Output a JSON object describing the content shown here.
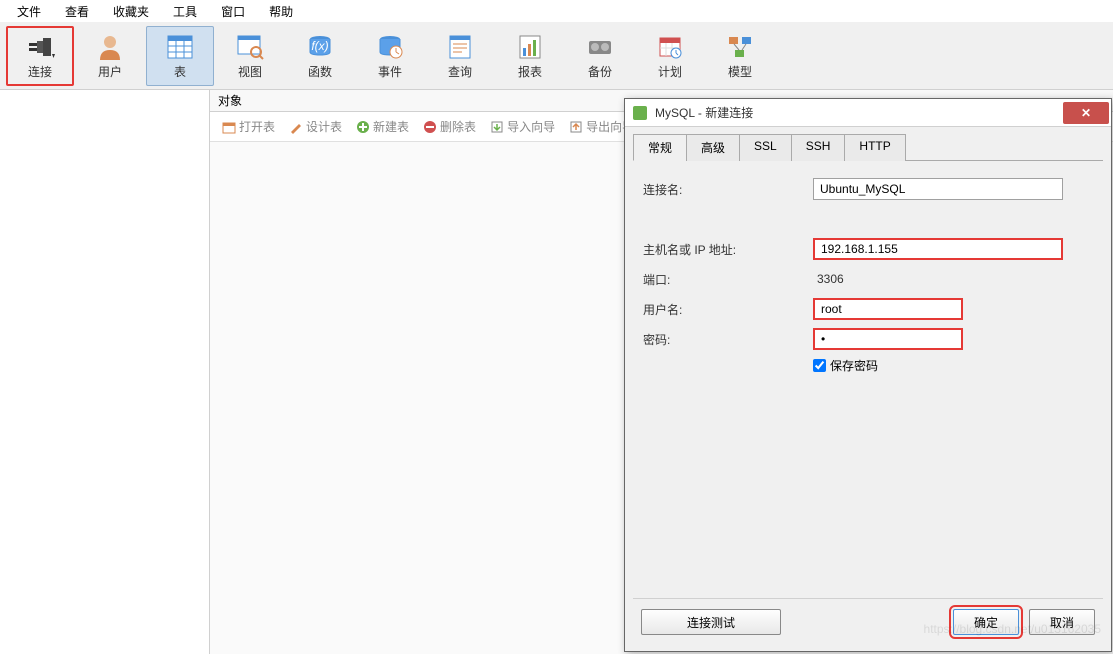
{
  "menu": {
    "items": [
      "文件",
      "查看",
      "收藏夹",
      "工具",
      "窗口",
      "帮助"
    ]
  },
  "toolbar": {
    "items": [
      {
        "label": "连接",
        "highlighted": true
      },
      {
        "label": "用户"
      },
      {
        "label": "表",
        "active": true
      },
      {
        "label": "视图"
      },
      {
        "label": "函数"
      },
      {
        "label": "事件"
      },
      {
        "label": "查询"
      },
      {
        "label": "报表"
      },
      {
        "label": "备份"
      },
      {
        "label": "计划"
      },
      {
        "label": "模型"
      }
    ]
  },
  "object_bar": {
    "label": "对象"
  },
  "sub_toolbar": {
    "items": [
      "打开表",
      "设计表",
      "新建表",
      "删除表",
      "导入向导",
      "导出向导"
    ]
  },
  "dialog": {
    "title": "MySQL - 新建连接",
    "tabs": [
      "常规",
      "高级",
      "SSL",
      "SSH",
      "HTTP"
    ],
    "active_tab": 0,
    "form": {
      "connection_label": "连接名:",
      "connection_value": "Ubuntu_MySQL",
      "host_label": "主机名或 IP 地址:",
      "host_value": "192.168.1.155",
      "port_label": "端口:",
      "port_value": "3306",
      "user_label": "用户名:",
      "user_value": "root",
      "password_label": "密码:",
      "password_value": "•",
      "save_password_label": "保存密码"
    },
    "buttons": {
      "test": "连接测试",
      "ok": "确定",
      "cancel": "取消"
    }
  }
}
